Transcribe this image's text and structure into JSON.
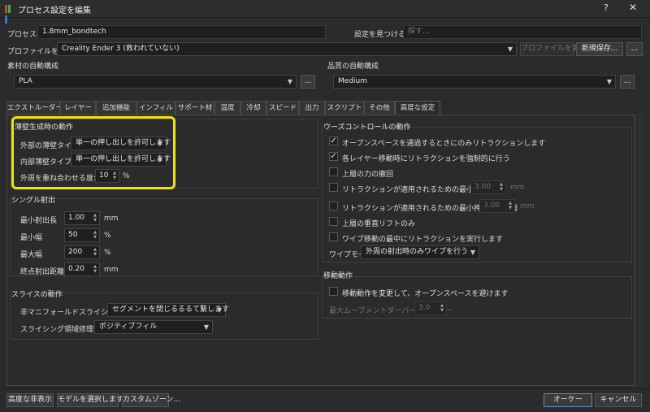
{
  "window": {
    "title": "プロセス設定を編集",
    "help": "?",
    "close": "✕",
    "icon_colors": [
      "#e33b3b",
      "#3bb34f",
      "#3b6fe3"
    ]
  },
  "process_name": {
    "label": "プロセス名",
    "value": "1.8mm_bondtech"
  },
  "search": {
    "label": "設定を見つける：",
    "placeholder": "探す..."
  },
  "profile": {
    "label": "プロファイルを選択",
    "value": "Creality Ender 3 (救われていない)",
    "update_button": "プロファイルを更新",
    "new_save_button": "新規保存...",
    "more_button": "..."
  },
  "material_auto": {
    "label": "素材の自動構成",
    "value": "PLA",
    "more_button": "..."
  },
  "quality_auto": {
    "label": "品質の自動構成",
    "value": "Medium",
    "more_button": "..."
  },
  "tabs": [
    "エクストルーダー",
    "レイヤー",
    "追加機能",
    "インフィル",
    "サポート材",
    "温度",
    "冷却",
    "スピード",
    "出力",
    "スクリプト",
    "その他",
    "高度な設定"
  ],
  "active_tab": "高度な設定",
  "thin_wall": {
    "title": "薄壁生成時の動作",
    "outer_label": "外部の薄壁タイプ",
    "outer_value": "単一の押し出しを許可します",
    "inner_label": "内部薄壁タイプ",
    "inner_value": "単一の押し出しを許可します",
    "overlap_label": "外周を重ね合わせる度合い",
    "overlap_value": "10",
    "overlap_unit": "%"
  },
  "single_extrusion": {
    "title": "シングル射出",
    "rows": [
      {
        "label": "最小射出長",
        "value": "1.00",
        "unit": "mm"
      },
      {
        "label": "最小幅",
        "value": "50",
        "unit": "%"
      },
      {
        "label": "最大幅",
        "value": "200",
        "unit": "%"
      },
      {
        "label": "終点射出距離",
        "value": "0.20",
        "unit": "mm"
      }
    ]
  },
  "slice": {
    "title": "スライスの動作",
    "nonmanifold_label": "非マニフォールドスライシング動作",
    "nonmanifold_value": "セグメントを閉じるるるて繋します",
    "repair_label": "スライシング領域修理モード",
    "repair_value": "ポジティブフィル"
  },
  "ooze": {
    "title": "ウーズコントロールの動作",
    "items": [
      {
        "label": "オープンスペースを通過するときにのみリトラクションします",
        "checked": "✓"
      },
      {
        "label": "各レイヤー移動時にリトラクションを強制的に行う",
        "checked": "✓"
      },
      {
        "label": "上層の力の撤回",
        "checked": ""
      },
      {
        "label": "リトラクションが適用されるための最小移動距離",
        "checked": "",
        "value": "3.00",
        "unit": "mm"
      },
      {
        "label": "リトラクションが適用されるための最小押し出し距離",
        "checked": "",
        "value": "3.00",
        "unit": "mm"
      },
      {
        "label": "上層の垂直リフトのみ",
        "checked": ""
      },
      {
        "label": "ワイプ移動の最中にリトラクションを実行します",
        "checked": ""
      }
    ],
    "wipe_label": "ワイプモード",
    "wipe_value": "外周の射出時のみワイプを行う"
  },
  "move": {
    "title": "移動動作",
    "avoid_label": "移動動作を変更して、オープンスペースを避けます",
    "avoid_checked": "",
    "factor_label": "最大ムーブメントダーパーファクター",
    "factor_value": "3.0"
  },
  "footer": {
    "hide_advanced": "高度な非表示",
    "select_model": "モデルを選択します...",
    "custom_zone": "カスタムゾーン...",
    "ok": "オーケー",
    "cancel": "キャンセル"
  },
  "colors": {
    "highlight": "#f2e600",
    "ok_border": "#5b8bd6"
  }
}
